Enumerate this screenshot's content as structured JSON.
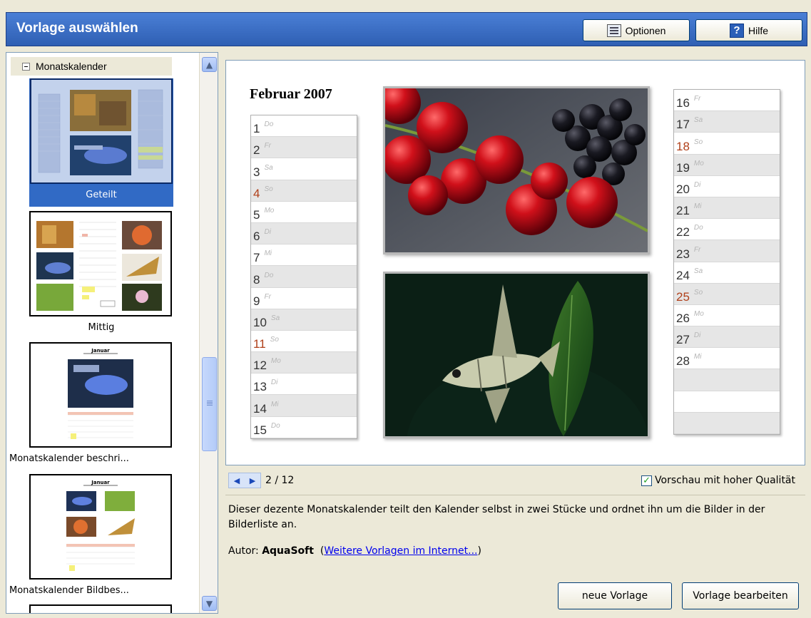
{
  "header": {
    "title": "Vorlage auswählen",
    "options_label": "Optionen",
    "help_label": "Hilfe"
  },
  "tree": {
    "group_label": "Monatskalender",
    "templates": [
      {
        "label": "Geteilt",
        "selected": true
      },
      {
        "label": "Mittig",
        "selected": false
      },
      {
        "label": "Monatskalender beschri...",
        "selected": false
      },
      {
        "label": "Monatskalender Bildbes...",
        "selected": false
      }
    ],
    "mini_month": "Januar"
  },
  "preview": {
    "title": "Februar 2007",
    "left_days": [
      {
        "num": "1",
        "dow": "Do"
      },
      {
        "num": "2",
        "dow": "Fr"
      },
      {
        "num": "3",
        "dow": "Sa"
      },
      {
        "num": "4",
        "dow": "So"
      },
      {
        "num": "5",
        "dow": "Mo"
      },
      {
        "num": "6",
        "dow": "Di"
      },
      {
        "num": "7",
        "dow": "Mi"
      },
      {
        "num": "8",
        "dow": "Do"
      },
      {
        "num": "9",
        "dow": "Fr"
      },
      {
        "num": "10",
        "dow": "Sa"
      },
      {
        "num": "11",
        "dow": "So"
      },
      {
        "num": "12",
        "dow": "Mo"
      },
      {
        "num": "13",
        "dow": "Di"
      },
      {
        "num": "14",
        "dow": "Mi"
      },
      {
        "num": "15",
        "dow": "Do"
      }
    ],
    "right_days": [
      {
        "num": "16",
        "dow": "Fr"
      },
      {
        "num": "17",
        "dow": "Sa"
      },
      {
        "num": "18",
        "dow": "So"
      },
      {
        "num": "19",
        "dow": "Mo"
      },
      {
        "num": "20",
        "dow": "Di"
      },
      {
        "num": "21",
        "dow": "Mi"
      },
      {
        "num": "22",
        "dow": "Do"
      },
      {
        "num": "23",
        "dow": "Fr"
      },
      {
        "num": "24",
        "dow": "Sa"
      },
      {
        "num": "25",
        "dow": "So"
      },
      {
        "num": "26",
        "dow": "Mo"
      },
      {
        "num": "27",
        "dow": "Di"
      },
      {
        "num": "28",
        "dow": "Mi"
      },
      {
        "num": "",
        "dow": ""
      },
      {
        "num": "",
        "dow": ""
      },
      {
        "num": "",
        "dow": ""
      }
    ],
    "sunday_color": "#b0401a"
  },
  "nav": {
    "page_indicator": "2 / 12",
    "hq_label": "Vorschau mit hoher Qualität",
    "hq_checked": true
  },
  "description": {
    "text": "Dieser dezente Monatskalender teilt den Kalender selbst in zwei Stücke und ordnet ihn um die Bilder in der Bilderliste an.",
    "author_prefix": "Autor:",
    "author_name": "AquaSoft",
    "more_link": "Weitere Vorlagen im Internet..."
  },
  "buttons": {
    "new_template": "neue Vorlage",
    "edit_template": "Vorlage bearbeiten"
  },
  "colors": {
    "header_blue": "#2f5fb3",
    "selection_blue": "#316ac5",
    "window_bg": "#ece9d8"
  }
}
